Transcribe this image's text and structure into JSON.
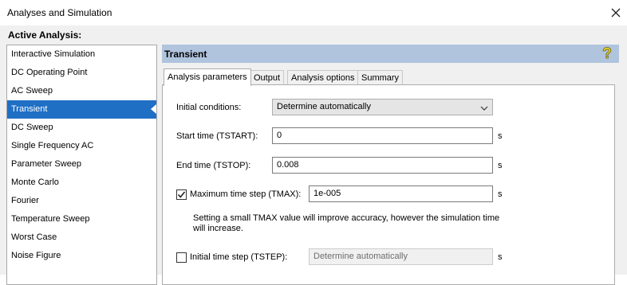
{
  "window": {
    "title": "Analyses and Simulation"
  },
  "sidebar": {
    "label": "Active Analysis:",
    "items": [
      {
        "label": "Interactive Simulation"
      },
      {
        "label": "DC Operating Point"
      },
      {
        "label": "AC Sweep"
      },
      {
        "label": "Transient"
      },
      {
        "label": "DC Sweep"
      },
      {
        "label": "Single Frequency AC"
      },
      {
        "label": "Parameter Sweep"
      },
      {
        "label": "Monte Carlo"
      },
      {
        "label": "Fourier"
      },
      {
        "label": "Temperature Sweep"
      },
      {
        "label": "Worst Case"
      },
      {
        "label": "Noise Figure"
      }
    ],
    "selected": "Transient"
  },
  "header": {
    "title": "Transient",
    "help_icon": "help-question-icon"
  },
  "tabs": [
    {
      "label": "Analysis parameters",
      "active": true
    },
    {
      "label": "Output"
    },
    {
      "label": "Analysis options"
    },
    {
      "label": "Summary"
    }
  ],
  "params": {
    "initial_conditions": {
      "label": "Initial conditions:",
      "value": "Determine automatically"
    },
    "start_time": {
      "label": "Start time (TSTART):",
      "value": "0",
      "unit": "s"
    },
    "end_time": {
      "label": "End time (TSTOP):",
      "value": "0.008",
      "unit": "s"
    },
    "max_step": {
      "label": "Maximum time step (TMAX):",
      "value": "1e-005",
      "unit": "s",
      "checked": true
    },
    "max_step_hint": "Setting a small TMAX value will improve accuracy, however the simulation time will increase.",
    "initial_step": {
      "label": "Initial time step (TSTEP):",
      "value": "Determine automatically",
      "unit": "s",
      "checked": false
    }
  },
  "colors": {
    "selection": "#1f6fc5",
    "header_bar": "#b0c4de",
    "dialog_bg": "#f0f0f0"
  }
}
